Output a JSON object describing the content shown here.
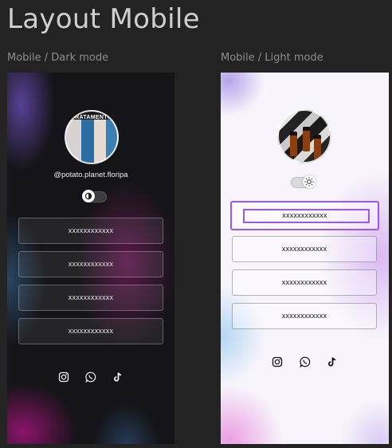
{
  "page": {
    "title": "Layout Mobile"
  },
  "dark": {
    "label": "Mobile / Dark mode",
    "avatar_text": "TRATAMENTO",
    "handle": "@potato.planet.floripa",
    "theme_icon": "half-moon-icon",
    "links": [
      "xxxxxxxxxxxx",
      "xxxxxxxxxxxx",
      "xxxxxxxxxxxx",
      "xxxxxxxxxxxx"
    ],
    "socials": [
      "instagram-icon",
      "whatsapp-icon",
      "tiktok-icon"
    ]
  },
  "light": {
    "label": "Mobile / Light mode",
    "theme_icon": "sun-icon",
    "links": [
      "xxxxxxxxxxxx",
      "xxxxxxxxxxxx",
      "xxxxxxxxxxxx",
      "xxxxxxxxxxxx"
    ],
    "selected_link_index": 0,
    "socials": [
      "instagram-icon",
      "whatsapp-icon",
      "tiktok-icon"
    ]
  },
  "colors": {
    "canvas_bg": "#232323",
    "selection": "#9b57ea",
    "dark_bg": "#151418",
    "light_bg": "#f7f4fb"
  }
}
